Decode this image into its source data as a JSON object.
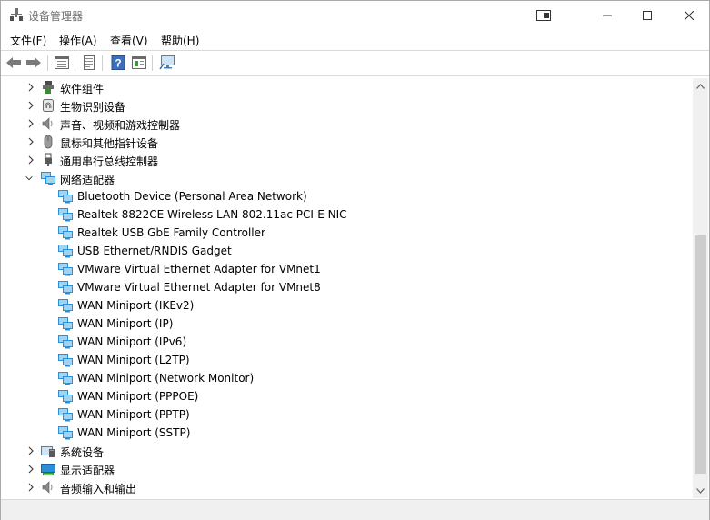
{
  "window": {
    "title": "设备管理器"
  },
  "menu": {
    "items": [
      "文件(F)",
      "操作(A)",
      "查看(V)",
      "帮助(H)"
    ]
  },
  "toolbar": {
    "buttons": [
      "back-arrow-icon",
      "forward-arrow-icon",
      "properties-list-icon",
      "update-driver-icon",
      "help-icon",
      "action-view-icon",
      "monitor-scan-icon"
    ]
  },
  "tree": {
    "categories_top": [
      {
        "label": "软件组件",
        "icon": "software-components-icon"
      },
      {
        "label": "生物识别设备",
        "icon": "biometric-icon"
      },
      {
        "label": "声音、视频和游戏控制器",
        "icon": "speaker-icon"
      },
      {
        "label": "鼠标和其他指针设备",
        "icon": "mouse-icon"
      },
      {
        "label": "通用串行总线控制器",
        "icon": "usb-icon"
      }
    ],
    "expanded_category": {
      "label": "网络适配器",
      "icon": "network-adapter-icon"
    },
    "network_adapters": [
      "Bluetooth Device (Personal Area Network)",
      "Realtek 8822CE Wireless LAN 802.11ac PCI-E NIC",
      "Realtek USB GbE Family Controller",
      "USB Ethernet/RNDIS Gadget",
      "VMware Virtual Ethernet Adapter for VMnet1",
      "VMware Virtual Ethernet Adapter for VMnet8",
      "WAN Miniport (IKEv2)",
      "WAN Miniport (IP)",
      "WAN Miniport (IPv6)",
      "WAN Miniport (L2TP)",
      "WAN Miniport (Network Monitor)",
      "WAN Miniport (PPPOE)",
      "WAN Miniport (PPTP)",
      "WAN Miniport (SSTP)"
    ],
    "categories_bottom": [
      {
        "label": "系统设备",
        "icon": "system-devices-icon"
      },
      {
        "label": "显示适配器",
        "icon": "display-adapter-icon"
      },
      {
        "label": "音频输入和输出",
        "icon": "audio-io-icon"
      }
    ]
  },
  "colors": {
    "network_icon": "#2a8fd6",
    "chevron": "#404040"
  }
}
